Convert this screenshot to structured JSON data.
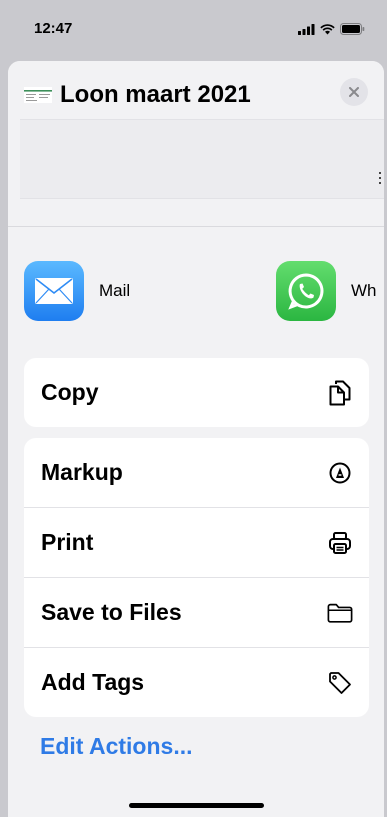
{
  "status_bar": {
    "time": "12:47",
    "icons": [
      "signal-icon",
      "wifi-icon",
      "battery-icon"
    ]
  },
  "header": {
    "title": "Loon maart 2021",
    "thumbnail_icon": "document-thumbnail-icon",
    "close_icon": "close-icon"
  },
  "apps": [
    {
      "label": "Mail",
      "icon": "mail-icon",
      "color": "#2f8cf5"
    },
    {
      "label": "Wh",
      "icon": "whatsapp-icon",
      "color": "#37c24a"
    }
  ],
  "actions_group_1": [
    {
      "label": "Copy",
      "icon": "copy-icon"
    }
  ],
  "actions_group_2": [
    {
      "label": "Markup",
      "icon": "markup-icon"
    },
    {
      "label": "Print",
      "icon": "printer-icon"
    },
    {
      "label": "Save to Files",
      "icon": "folder-icon"
    },
    {
      "label": "Add Tags",
      "icon": "tag-icon"
    }
  ],
  "edit_actions_label": "Edit Actions...",
  "colors": {
    "accent": "#2f7be6",
    "sheet_background": "#f2f2f4",
    "backdrop": "#c9c9ce"
  }
}
